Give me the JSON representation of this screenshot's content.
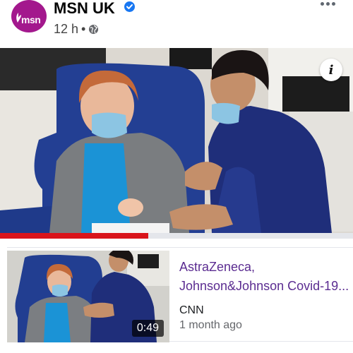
{
  "post": {
    "page_name": "MSN UK",
    "avatar_text": "msn",
    "time": "12 h",
    "separator": "•",
    "verified": true,
    "privacy_icon": "globe-icon",
    "more_icon": "more-dots-icon"
  },
  "media": {
    "info_label": "i",
    "progress": 0.42,
    "progress_color": "#d9141b"
  },
  "related": {
    "title_line1": "AstraZeneca,",
    "title_line2": "Johnson&Johnson Covid-19...",
    "source": "CNN",
    "time": "1 month ago",
    "duration": "0:49"
  },
  "colors": {
    "brand": "#a3188d",
    "verified": "#1877f2",
    "title_link": "#5b2c91"
  }
}
